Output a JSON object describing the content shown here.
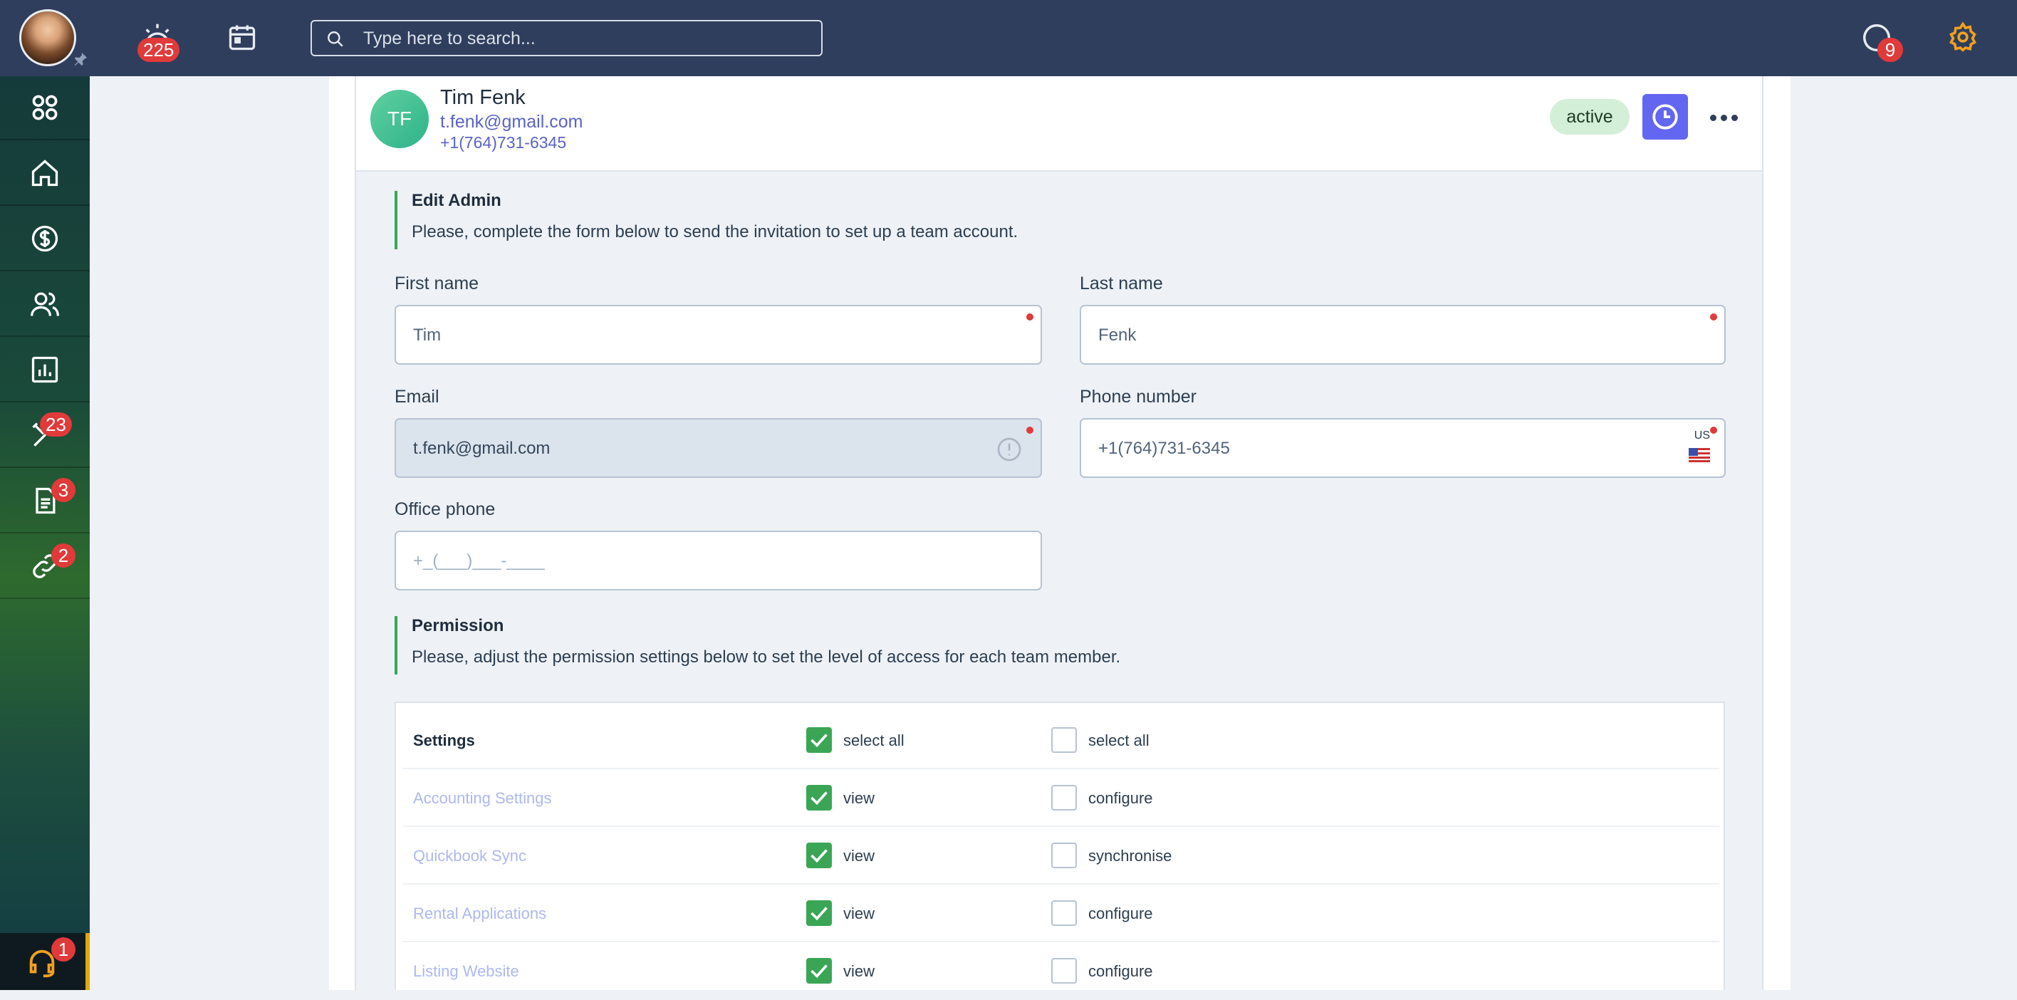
{
  "topbar": {
    "tasks_badge": "225",
    "search_placeholder": "Type here to search...",
    "messages_badge": "9"
  },
  "sidebar": {
    "items": [
      {
        "icon": "apps-icon",
        "badge": ""
      },
      {
        "icon": "home-icon",
        "badge": ""
      },
      {
        "icon": "dollar-icon",
        "badge": ""
      },
      {
        "icon": "users-icon",
        "badge": ""
      },
      {
        "icon": "chart-icon",
        "badge": ""
      },
      {
        "icon": "tools-icon",
        "badge": "23"
      },
      {
        "icon": "document-icon",
        "badge": "3"
      },
      {
        "icon": "link-icon",
        "badge": "2"
      }
    ],
    "support_badge": "1"
  },
  "profile": {
    "initials": "TF",
    "name": "Tim Fenk",
    "email": "t.fenk@gmail.com",
    "phone": "+1(764)731-6345",
    "status": "active"
  },
  "edit_section": {
    "title": "Edit Admin",
    "description": "Please, complete the form below to send the invitation to set up a team account."
  },
  "form": {
    "first_name": {
      "label": "First name",
      "value": "Tim"
    },
    "last_name": {
      "label": "Last name",
      "value": "Fenk"
    },
    "email": {
      "label": "Email",
      "value": "t.fenk@gmail.com"
    },
    "phone": {
      "label": "Phone number",
      "value": "+1(764)731-6345",
      "country": "US"
    },
    "office_phone": {
      "label": "Office phone",
      "placeholder": "+_(___)___-____"
    }
  },
  "permission_section": {
    "title": "Permission",
    "description": "Please, adjust the permission settings below to set the level of access for each team member."
  },
  "permissions": {
    "header": {
      "name": "Settings",
      "col1": "select all",
      "col2": "select all"
    },
    "rows": [
      {
        "name": "Accounting Settings",
        "col1": "view",
        "col2": "configure"
      },
      {
        "name": "Quickbook Sync",
        "col1": "view",
        "col2": "synchronise"
      },
      {
        "name": "Rental Applications",
        "col1": "view",
        "col2": "configure"
      },
      {
        "name": "Listing Website",
        "col1": "view",
        "col2": "configure"
      }
    ]
  }
}
